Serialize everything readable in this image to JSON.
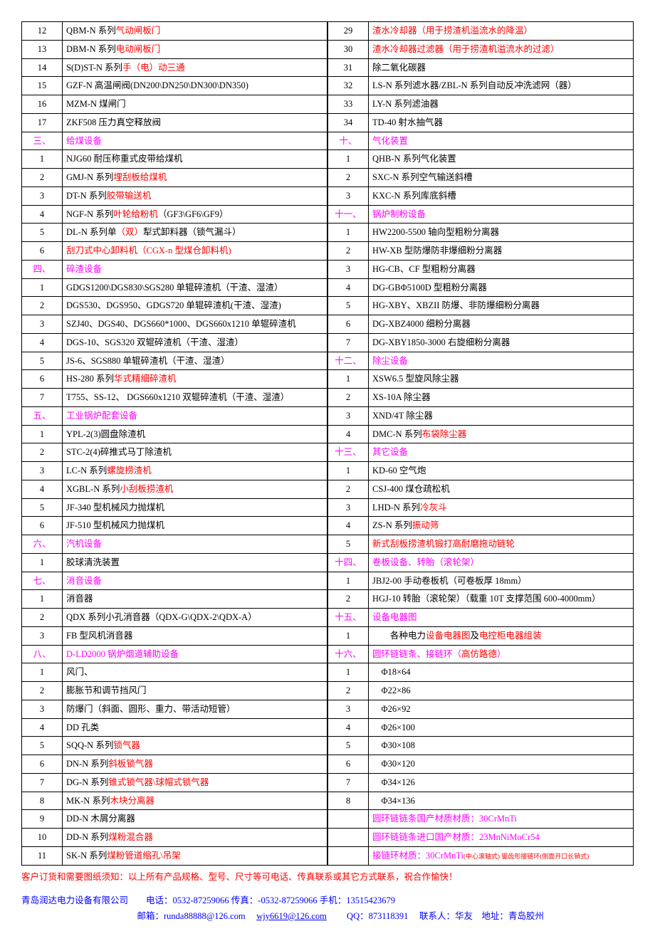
{
  "left": [
    {
      "n": "12",
      "spans": [
        {
          "t": "QBM-N 系列"
        },
        {
          "c": "red",
          "t": "气动闸板门"
        }
      ]
    },
    {
      "n": "13",
      "spans": [
        {
          "t": "DBM-N 系列"
        },
        {
          "c": "red",
          "t": "电动闸板门"
        }
      ]
    },
    {
      "n": "14",
      "spans": [
        {
          "t": "S(D)ST-N 系列"
        },
        {
          "c": "red",
          "t": "手（电）动三通"
        }
      ]
    },
    {
      "n": "15",
      "spans": [
        {
          "t": "GZF-N 高温闸阀(DN200\\DN250\\DN300\\DN350)"
        }
      ]
    },
    {
      "n": "16",
      "spans": [
        {
          "t": "MZM-N 煤闸门"
        }
      ]
    },
    {
      "n": "17",
      "spans": [
        {
          "t": "ZKF508 压力真空释放阀"
        }
      ]
    },
    {
      "n": "三、",
      "nc": "magenta",
      "spans": [
        {
          "c": "magenta",
          "t": "给煤设备"
        }
      ]
    },
    {
      "n": "1",
      "spans": [
        {
          "t": "NJG60 耐压称重式皮带给煤机"
        }
      ]
    },
    {
      "n": "2",
      "spans": [
        {
          "t": "GMJ-N 系列"
        },
        {
          "c": "red",
          "t": "埋刮板给煤机"
        }
      ]
    },
    {
      "n": "3",
      "spans": [
        {
          "t": "DT-N 系列"
        },
        {
          "c": "red",
          "t": "胶带输送机"
        }
      ]
    },
    {
      "n": "4",
      "spans": [
        {
          "t": "NGF-N 系列"
        },
        {
          "c": "red",
          "t": "叶轮给粉机"
        },
        {
          "t": "（GF3\\GF6\\GF9）"
        }
      ]
    },
    {
      "n": "5",
      "spans": [
        {
          "t": "DL-N 系列单"
        },
        {
          "c": "red",
          "t": "（双）"
        },
        {
          "t": "犁式卸料器（锁气漏斗）"
        }
      ]
    },
    {
      "n": "6",
      "spans": [
        {
          "c": "red",
          "t": "刮刀式中心卸料机"
        },
        {
          "c": "red",
          "t": "（CGX-n 型煤仓卸料机)"
        }
      ]
    },
    {
      "n": "四、",
      "nc": "magenta",
      "spans": [
        {
          "c": "magenta",
          "t": "碎渣设备"
        }
      ]
    },
    {
      "n": "1",
      "spans": [
        {
          "t": "GDGS1200\\DGS830\\SGS280 单辊碎渣机（干渣、湿渣）"
        }
      ]
    },
    {
      "n": "2",
      "spans": [
        {
          "t": "DGS530、DGS950、GDGS720 单辊碎渣机(干渣、湿渣)"
        }
      ]
    },
    {
      "n": "3",
      "spans": [
        {
          "t": "SZJ40、DGS40、DGS660*1000、DGS660x1210 单辊碎渣机"
        }
      ]
    },
    {
      "n": "4",
      "spans": [
        {
          "t": "DGS-10、SGS320 双辊碎渣机（干渣、湿渣）"
        }
      ]
    },
    {
      "n": "5",
      "spans": [
        {
          "t": "JS-6、SGS880 单辊碎渣机（干渣、湿渣）"
        }
      ]
    },
    {
      "n": "6",
      "spans": [
        {
          "t": "HS-280 系列"
        },
        {
          "c": "red",
          "t": "华式精细碎渣机"
        }
      ]
    },
    {
      "n": "7",
      "spans": [
        {
          "t": "T755、SS-12、 DGS660x1210 双辊碎渣机（干渣、湿渣）"
        }
      ]
    },
    {
      "n": "五、",
      "nc": "magenta",
      "spans": [
        {
          "c": "magenta",
          "t": "工业锅炉配套设备"
        }
      ]
    },
    {
      "n": "1",
      "spans": [
        {
          "t": "YPL-2(3)圆盘除渣机"
        }
      ]
    },
    {
      "n": "2",
      "spans": [
        {
          "t": "STC-2(4)碎推式马丁除渣机"
        }
      ]
    },
    {
      "n": "3",
      "spans": [
        {
          "t": "LC-N 系列"
        },
        {
          "c": "red",
          "t": "螺旋捞渣机"
        }
      ]
    },
    {
      "n": "4",
      "spans": [
        {
          "t": "XGBL-N 系列"
        },
        {
          "c": "red",
          "t": "小刮板捞渣机"
        }
      ]
    },
    {
      "n": "5",
      "spans": [
        {
          "t": "JF-340 型机械风力抛煤机"
        }
      ]
    },
    {
      "n": "6",
      "spans": [
        {
          "t": "JF-510 型机械风力抛煤机"
        }
      ]
    },
    {
      "n": "六、",
      "nc": "magenta",
      "spans": [
        {
          "c": "magenta",
          "t": "汽机设备"
        }
      ]
    },
    {
      "n": "1",
      "spans": [
        {
          "t": "胶球清洗装置"
        }
      ]
    },
    {
      "n": "七、",
      "nc": "magenta",
      "spans": [
        {
          "c": "magenta",
          "t": "消音设备"
        }
      ]
    },
    {
      "n": "1",
      "spans": [
        {
          "t": "消音器"
        }
      ]
    },
    {
      "n": "2",
      "spans": [
        {
          "t": "QDX 系列小孔消音器（QDX-G\\QDX-2\\QDX-A）"
        }
      ]
    },
    {
      "n": "3",
      "spans": [
        {
          "t": "FB 型风机消音器"
        }
      ]
    },
    {
      "n": "八、",
      "nc": "magenta",
      "spans": [
        {
          "c": "magenta",
          "t": "D-LD2000 锅炉烟道辅助设备"
        }
      ]
    },
    {
      "n": "1",
      "spans": [
        {
          "t": "风门、"
        }
      ]
    },
    {
      "n": "2",
      "spans": [
        {
          "t": "膨胀节和调节挡风门"
        }
      ]
    },
    {
      "n": "3",
      "spans": [
        {
          "t": "防爆门（斜面、圆形、重力、带活动短管）"
        }
      ]
    },
    {
      "n": "4",
      "spans": [
        {
          "t": "DD 孔类"
        }
      ]
    },
    {
      "n": "5",
      "spans": [
        {
          "t": "SQQ-N 系列"
        },
        {
          "c": "red",
          "t": "锁气器"
        }
      ]
    },
    {
      "n": "6",
      "spans": [
        {
          "t": "DN-N 系列"
        },
        {
          "c": "red",
          "t": "斜板锁气器"
        }
      ]
    },
    {
      "n": "7",
      "spans": [
        {
          "t": "DG-N 系列"
        },
        {
          "c": "red",
          "t": "锥式锁气器\\球帽式锁气器"
        }
      ]
    },
    {
      "n": "8",
      "spans": [
        {
          "t": "MK-N 系列"
        },
        {
          "c": "red",
          "t": "木块分离器"
        }
      ]
    },
    {
      "n": "9",
      "spans": [
        {
          "t": "DD-N 木屑分离器"
        }
      ]
    },
    {
      "n": "10",
      "spans": [
        {
          "t": "DD-N 系列"
        },
        {
          "c": "red",
          "t": "煤粉混合器"
        }
      ]
    },
    {
      "n": "11",
      "spans": [
        {
          "t": "SK-N 系列"
        },
        {
          "c": "red",
          "t": "煤粉管道缩孔\\吊架"
        }
      ]
    }
  ],
  "right": [
    {
      "n": "29",
      "spans": [
        {
          "c": "red",
          "t": "渣水冷却器（用于捞渣机溢流水的降温）"
        }
      ]
    },
    {
      "n": "30",
      "spans": [
        {
          "c": "red",
          "t": "渣水冷却器过滤器（用于捞渣机溢流水的过滤）"
        }
      ]
    },
    {
      "n": "31",
      "spans": [
        {
          "t": "除二氧化碳器"
        }
      ]
    },
    {
      "n": "32",
      "spans": [
        {
          "t": "LS-N 系列滤水器/ZBL-N 系列自动反冲洗滤网（器）"
        }
      ]
    },
    {
      "n": "33",
      "spans": [
        {
          "t": "LY-N 系列滤油器"
        }
      ]
    },
    {
      "n": "34",
      "spans": [
        {
          "t": "TD-40 射水抽气器"
        }
      ]
    },
    {
      "n": "十、",
      "nc": "magenta",
      "spans": [
        {
          "c": "magenta",
          "t": "气化装置"
        }
      ]
    },
    {
      "n": "1",
      "spans": [
        {
          "t": "QHB-N 系列气化装置"
        }
      ]
    },
    {
      "n": "2",
      "spans": [
        {
          "t": "SXC-N 系列空气输送斜槽"
        }
      ]
    },
    {
      "n": "3",
      "spans": [
        {
          "t": "KXC-N 系列库底斜槽"
        }
      ]
    },
    {
      "n": "十一、",
      "nc": "magenta",
      "spans": [
        {
          "c": "magenta",
          "t": "锅炉制粉设备"
        }
      ]
    },
    {
      "n": "1",
      "spans": [
        {
          "t": "HW2200-5500 轴向型粗粉分离器"
        }
      ]
    },
    {
      "n": "2",
      "spans": [
        {
          "t": "HW-XB 型防爆防非爆细粉分离器"
        }
      ]
    },
    {
      "n": "3",
      "spans": [
        {
          "t": "HG-CB、CF 型粗粉分离器"
        }
      ]
    },
    {
      "n": "4",
      "spans": [
        {
          "t": "DG-GBΦ5100D 型粗粉分离器"
        }
      ]
    },
    {
      "n": "5",
      "spans": [
        {
          "t": "HG-XBY、XBZII 防爆、非防爆细粉分离器"
        }
      ]
    },
    {
      "n": "6",
      "spans": [
        {
          "t": "DG-XBZ4000 细粉分离器"
        }
      ]
    },
    {
      "n": "7",
      "spans": [
        {
          "t": "DG-XBY1850-3000 右旋细粉分离器"
        }
      ]
    },
    {
      "n": "十二、",
      "nc": "magenta",
      "spans": [
        {
          "c": "magenta",
          "t": "除尘设备"
        }
      ]
    },
    {
      "n": "1",
      "spans": [
        {
          "t": "XSW6.5 型旋风除尘器"
        }
      ]
    },
    {
      "n": "2",
      "spans": [
        {
          "t": "XS-10A 除尘器"
        }
      ]
    },
    {
      "n": "3",
      "spans": [
        {
          "t": "XND/4T 除尘器"
        }
      ]
    },
    {
      "n": "4",
      "spans": [
        {
          "t": "DMC-N 系列"
        },
        {
          "c": "red",
          "t": "布袋除尘器"
        }
      ]
    },
    {
      "n": "十三、",
      "nc": "magenta",
      "spans": [
        {
          "c": "magenta",
          "t": "其它设备"
        }
      ]
    },
    {
      "n": "1",
      "spans": [
        {
          "t": "KD-60 空气炮"
        }
      ]
    },
    {
      "n": "2",
      "spans": [
        {
          "t": "CSJ-400 煤仓疏松机"
        }
      ]
    },
    {
      "n": "3",
      "spans": [
        {
          "t": "LHD-N 系列"
        },
        {
          "c": "red",
          "t": "冷灰斗"
        }
      ]
    },
    {
      "n": "4",
      "spans": [
        {
          "t": "ZS-N 系列"
        },
        {
          "c": "red",
          "t": "振动筛"
        }
      ]
    },
    {
      "n": "5",
      "spans": [
        {
          "c": "red",
          "t": "新式刮板捞渣机锻打高耐磨拖动链轮"
        }
      ]
    },
    {
      "n": "十四、",
      "nc": "magenta",
      "spans": [
        {
          "c": "magenta",
          "t": "卷板设备、转胎（滚轮架）"
        }
      ]
    },
    {
      "n": "1",
      "spans": [
        {
          "t": "JBJ2-00 手动卷板机（可卷板厚 18mm）"
        }
      ]
    },
    {
      "n": "2",
      "spans": [
        {
          "t": "HGJ-10 转胎（滚轮架）（载重 10T 支撑范围 600-4000mm）"
        }
      ]
    },
    {
      "n": "十五、",
      "nc": "magenta",
      "spans": [
        {
          "c": "magenta",
          "t": "设备电器图"
        }
      ]
    },
    {
      "n": "1",
      "spans": [
        {
          "t": "　　各种电力"
        },
        {
          "c": "red",
          "t": "设备电器图"
        },
        {
          "t": "及"
        },
        {
          "c": "red",
          "t": "电控柜电器组装"
        }
      ]
    },
    {
      "n": "十六、",
      "nc": "magenta",
      "spans": [
        {
          "c": "magenta",
          "t": "圆环链链条、接链环（"
        },
        {
          "c": "red",
          "t": "高仿路德"
        },
        {
          "c": "magenta",
          "t": "）"
        }
      ]
    },
    {
      "n": "1",
      "spans": [
        {
          "t": "　Φ18×64"
        }
      ]
    },
    {
      "n": "2",
      "spans": [
        {
          "t": "　Φ22×86"
        }
      ]
    },
    {
      "n": "3",
      "spans": [
        {
          "t": "　Φ26×92"
        }
      ]
    },
    {
      "n": "4",
      "spans": [
        {
          "t": "　Φ26×100"
        }
      ]
    },
    {
      "n": "5",
      "spans": [
        {
          "t": "　Φ30×108"
        }
      ]
    },
    {
      "n": "6",
      "spans": [
        {
          "t": "　Φ30×120"
        }
      ]
    },
    {
      "n": "7",
      "spans": [
        {
          "t": "　Φ34×126"
        }
      ]
    },
    {
      "n": "8",
      "spans": [
        {
          "t": "　Φ34×136"
        }
      ]
    },
    {
      "n": "",
      "spans": [
        {
          "c": "magenta",
          "t": "圆环链链条国产材质材质：30CrMnTi"
        }
      ]
    },
    {
      "n": "",
      "spans": [
        {
          "c": "magenta",
          "t": "圆环链链条进口国产材质：23MnNiMoCr54"
        }
      ]
    },
    {
      "n": "",
      "spans": [
        {
          "c": "magenta",
          "t": "接链环材质：30CrMnTi"
        },
        {
          "c": "red",
          "t": "(中心滚轴式)  锯齿形接链环(侧面开口长销式)",
          "tiny": true
        }
      ]
    }
  ],
  "footer_note": {
    "spans": [
      {
        "c": "red",
        "t": "客户订货和需要图纸须知：以上所有产品规格、型号、尺寸等可电话、传真联系或其它方式联系，祝合作愉快！"
      }
    ]
  },
  "footer_company": {
    "line1_prefix": "青岛润达电力设备有限公司　　电话：0532-87259066  传真：-0532-87259066  手机：13515423679",
    "line2_prefix": "　　　　　　　　　　　　　邮箱：runda88888@126.com　",
    "email_link": "wjy6619@126.com",
    "line2_suffix": "　　QQ：873118391　 联系人：华友　地址：青岛胶州"
  }
}
